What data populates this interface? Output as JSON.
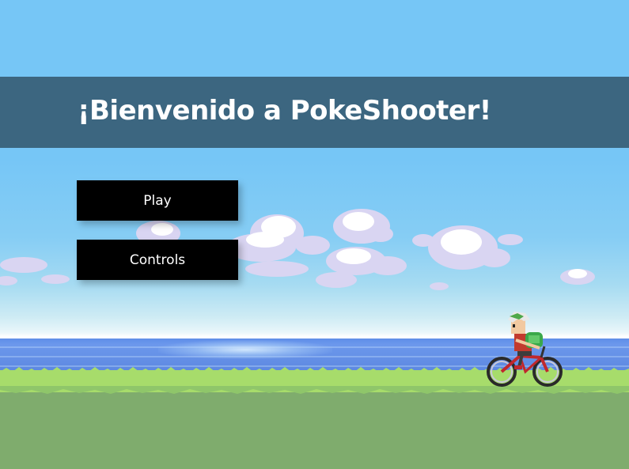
{
  "header": {
    "title": "¡Bienvenido a PokeShooter!"
  },
  "menu": {
    "play_label": "Play",
    "controls_label": "Controls"
  },
  "colors": {
    "sky": "#76c6f6",
    "header_bar": "#3c6680",
    "button_bg": "#000000",
    "button_text": "#ffffff",
    "sea": "#5f8ee8",
    "grass_light": "#a7dc6b",
    "grass_dark": "#7fac6d"
  },
  "icons": {
    "character": "cyclist-trainer-sprite"
  }
}
